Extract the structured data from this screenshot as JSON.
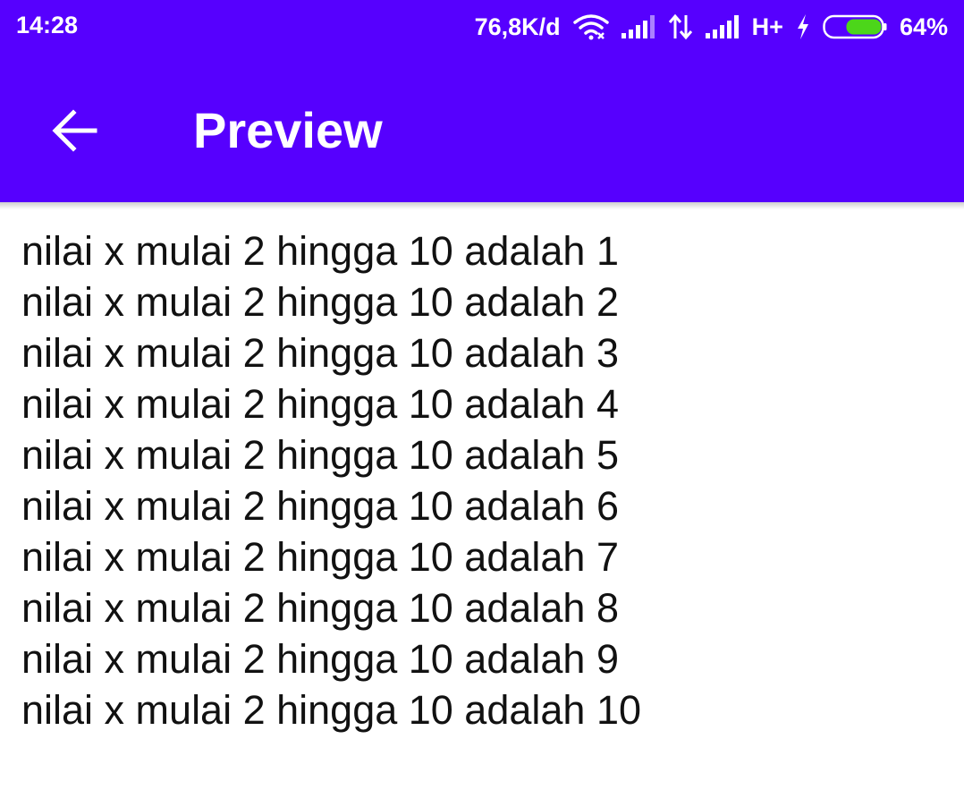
{
  "status_bar": {
    "time": "14:28",
    "network_speed": "76,8K/d",
    "network_type": "H+",
    "battery_percent": "64%",
    "battery_level": 0.64,
    "battery_color": "#4cd61a",
    "icons": [
      "wifi-icon",
      "signal-1-icon",
      "data-transfer-icon",
      "signal-2-icon",
      "charging-icon",
      "battery-icon"
    ]
  },
  "colors": {
    "app_bar": "#5600fe",
    "text": "#111111"
  },
  "toolbar": {
    "title": "Preview",
    "back_icon": "arrow-back-icon"
  },
  "output_lines": [
    "nilai x mulai 2 hingga 10 adalah 1",
    "nilai x mulai 2 hingga 10 adalah 2",
    "nilai x mulai 2 hingga 10 adalah 3",
    "nilai x mulai 2 hingga 10 adalah 4",
    "nilai x mulai 2 hingga 10 adalah 5",
    "nilai x mulai 2 hingga 10 adalah 6",
    "nilai x mulai 2 hingga 10 adalah 7",
    "nilai x mulai 2 hingga 10 adalah 8",
    "nilai x mulai 2 hingga 10 adalah 9",
    "nilai x mulai 2 hingga 10 adalah 10"
  ]
}
